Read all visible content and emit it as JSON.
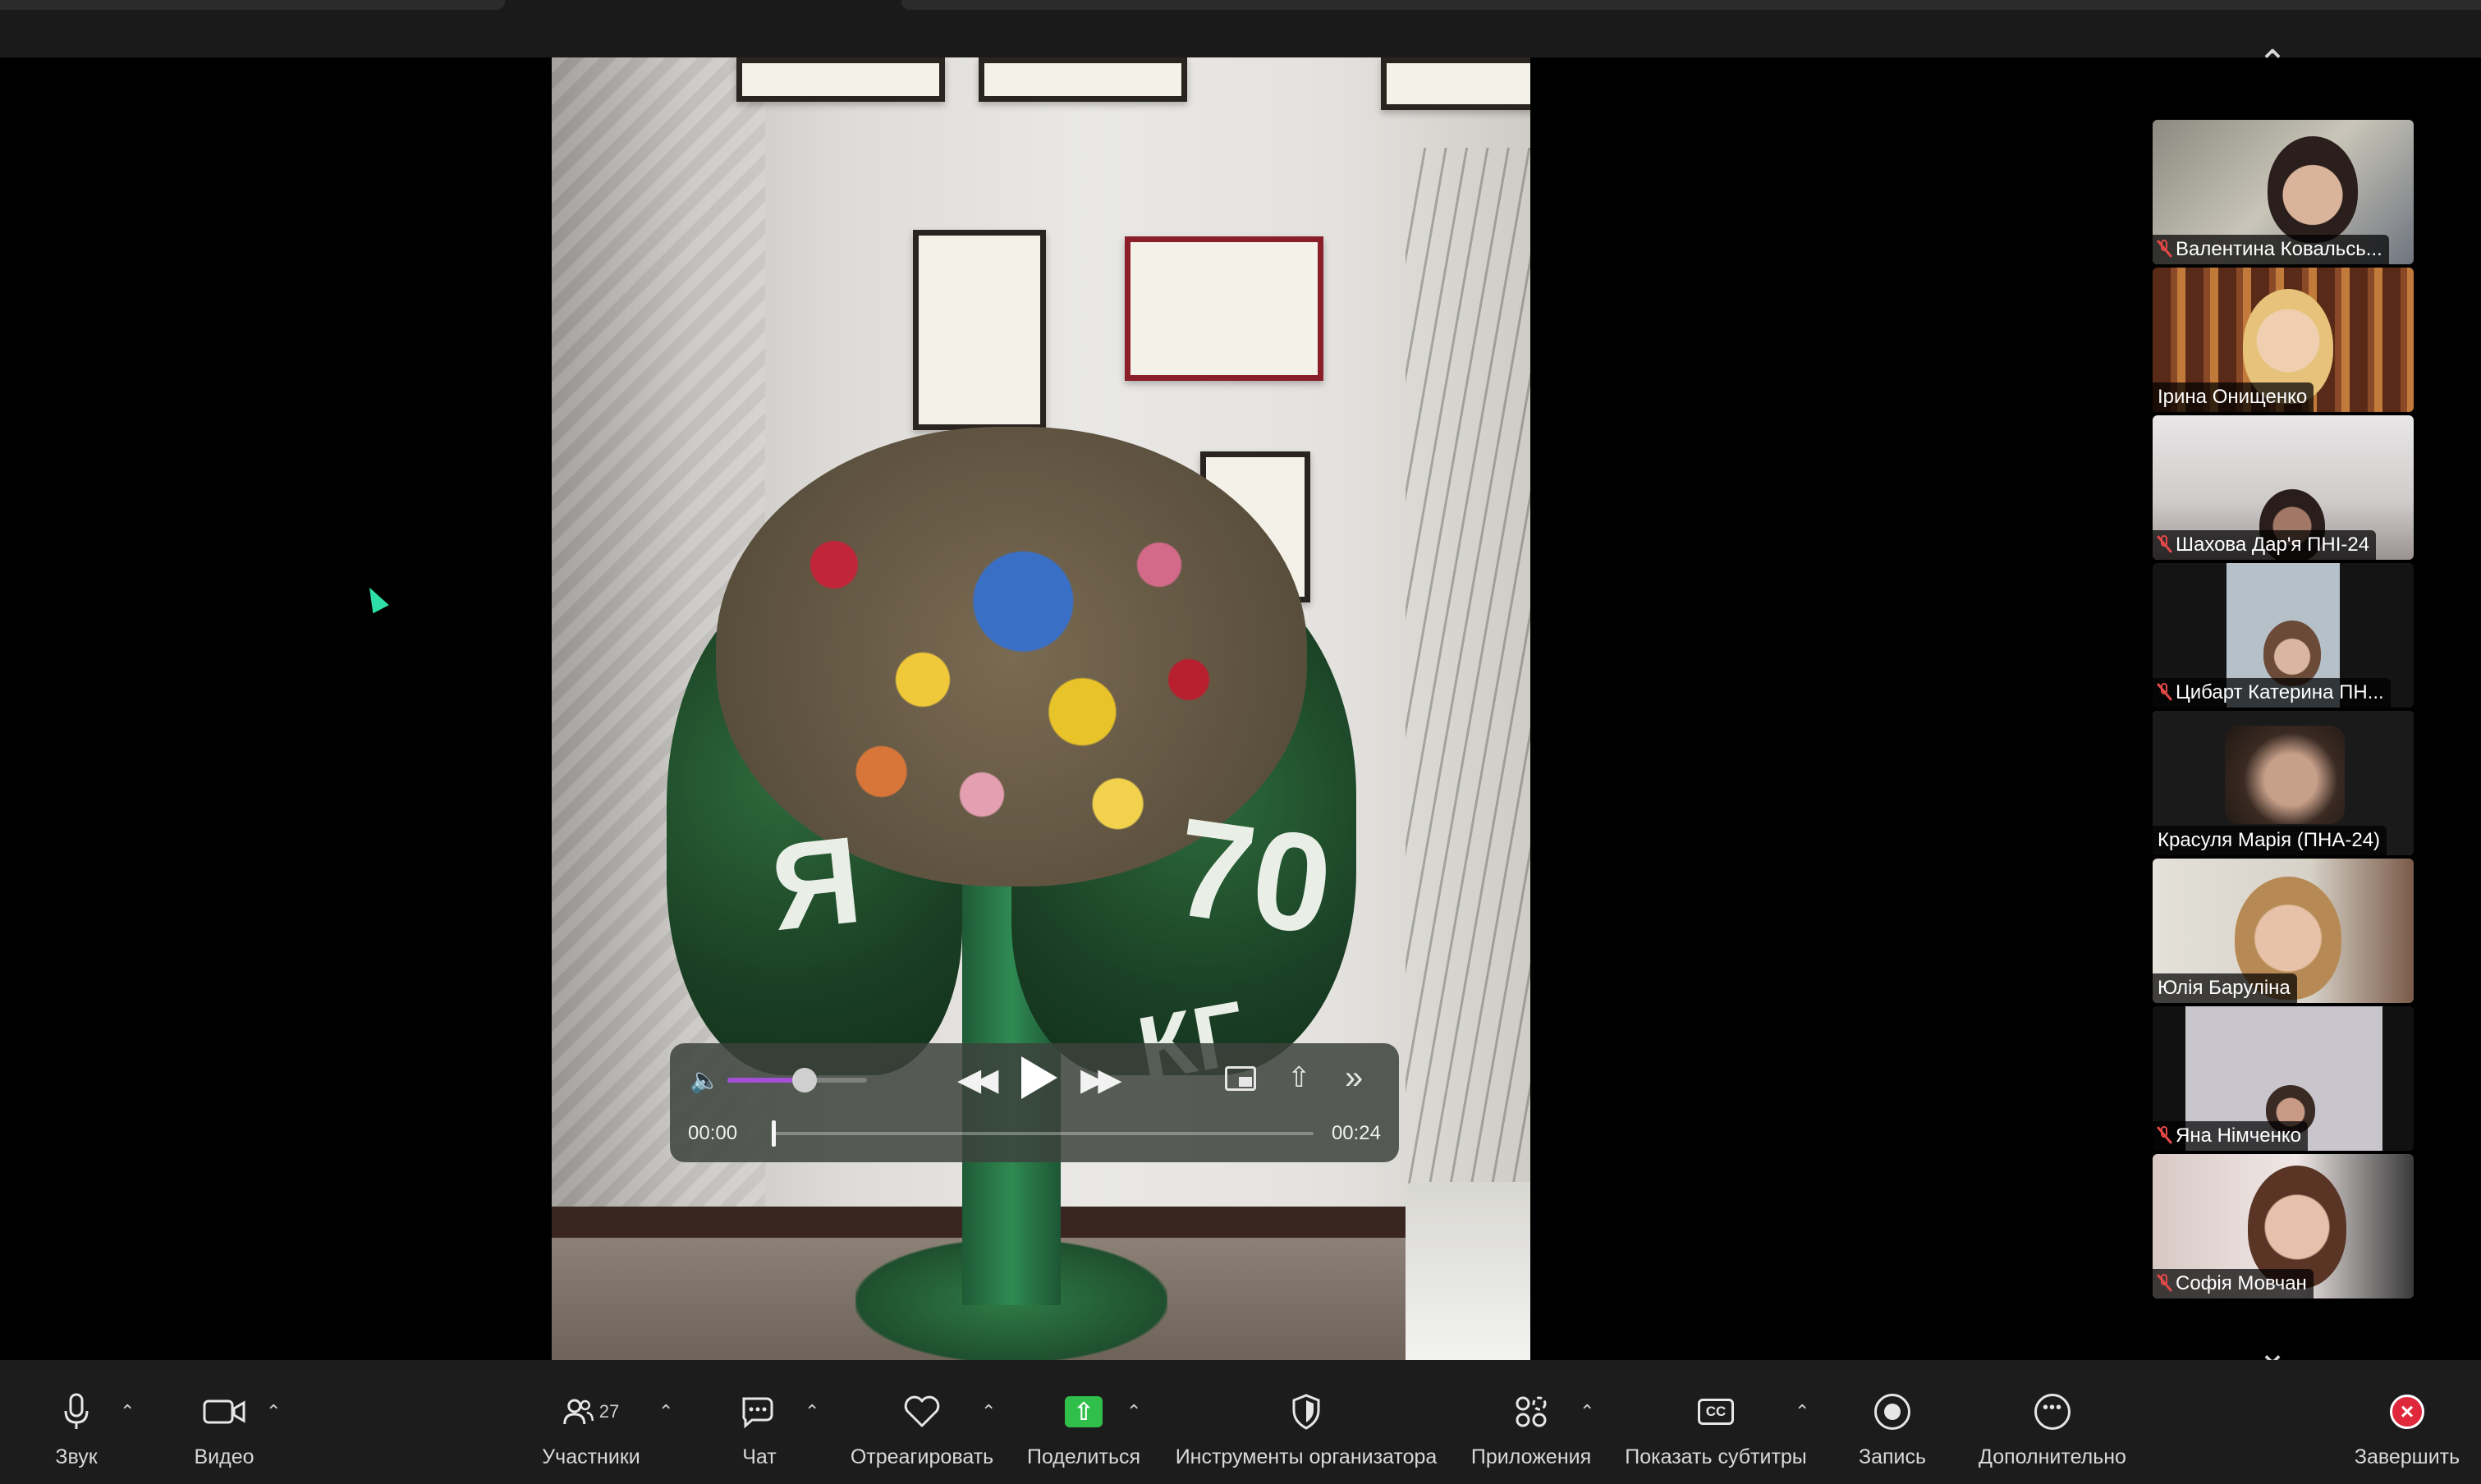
{
  "player": {
    "time_current": "00:00",
    "time_total": "00:24",
    "volume_level": 0.55,
    "progress": 0.0
  },
  "video_content": {
    "letter_left": "Я",
    "number_right": "70",
    "letters_bottom": "КГ"
  },
  "participants": [
    {
      "name": "Валентина Ковальсь...",
      "muted": true,
      "active": false
    },
    {
      "name": "Ірина Онищенко",
      "muted": false,
      "active": false
    },
    {
      "name": "Шахова Дар'я ПНІ-24",
      "muted": true,
      "active": false
    },
    {
      "name": "Цибарт Катерина ПН...",
      "muted": true,
      "active": false
    },
    {
      "name": "Красуля Марія (ПНА-24)",
      "muted": false,
      "active": true
    },
    {
      "name": "Юлія Баруліна",
      "muted": false,
      "active": false
    },
    {
      "name": "Яна Німченко",
      "muted": true,
      "active": false
    },
    {
      "name": "Софія Мовчан",
      "muted": true,
      "active": false
    }
  ],
  "toolbar": {
    "audio": "Звук",
    "video": "Видео",
    "participants": "Участники",
    "participants_count": "27",
    "chat": "Чат",
    "react": "Отреагировать",
    "share": "Поделиться",
    "host_tools": "Инструменты организатора",
    "apps": "Приложения",
    "captions": "Показать субтитры",
    "record": "Запись",
    "more": "Дополнительно",
    "end": "Завершить"
  },
  "colors": {
    "active_speaker": "#3fbf5a",
    "share_green": "#2fbf4a",
    "end_red": "#e0283c",
    "muted_red": "#e54848",
    "volume_purple": "#a34fd6"
  },
  "icons": {
    "scroll_up": "chevron-up-icon",
    "scroll_down": "chevron-down-icon"
  }
}
